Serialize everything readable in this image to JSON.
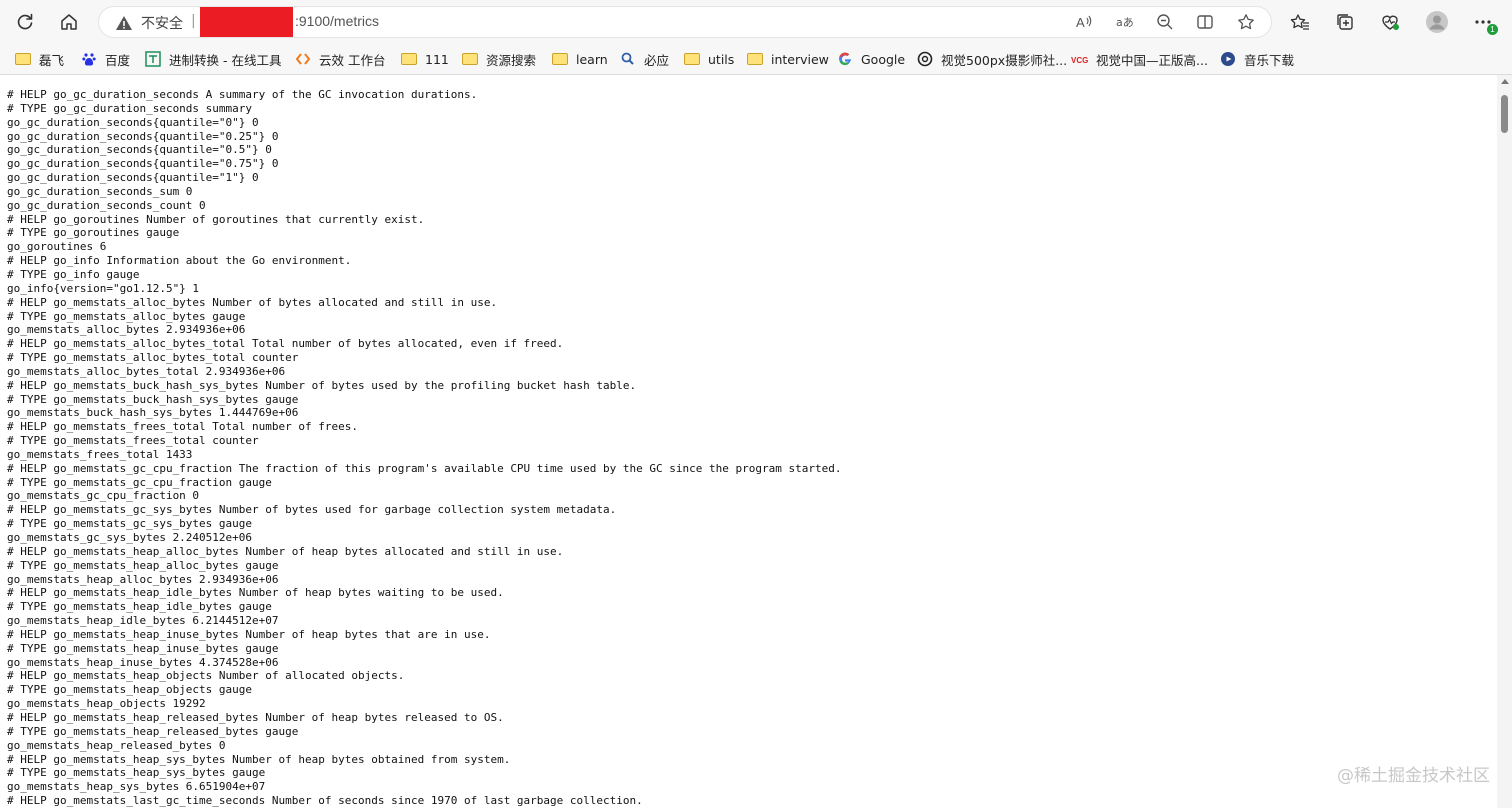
{
  "address_bar": {
    "security_label": "不安全",
    "separator": "|",
    "url_suffix": ":9100/metrics"
  },
  "icons": {
    "reload": "reload-icon",
    "home": "home-icon",
    "warning": "warning-icon",
    "read_aloud": "read-aloud-icon",
    "translate": "translate-icon",
    "zoom": "zoom-icon",
    "split_screen": "split-screen-icon",
    "favorite": "star-icon",
    "favorites": "favorites-icon",
    "collections": "collections-icon",
    "health": "browser-essentials-icon",
    "profile": "profile-icon",
    "more": "more-icon"
  },
  "extension_badge": "1",
  "bookmarks": [
    {
      "label": "磊飞",
      "icon": "folder"
    },
    {
      "label": "百度",
      "icon": "baidu"
    },
    {
      "label": "进制转换 - 在线工具",
      "icon": "tool"
    },
    {
      "label": "云效 工作台",
      "icon": "yunxiao"
    },
    {
      "label": "111",
      "icon": "folder"
    },
    {
      "label": "资源搜索",
      "icon": "folder"
    },
    {
      "label": "learn",
      "icon": "folder"
    },
    {
      "label": "必应",
      "icon": "search"
    },
    {
      "label": "utils",
      "icon": "folder"
    },
    {
      "label": "interview",
      "icon": "folder"
    },
    {
      "label": "Google",
      "icon": "google"
    },
    {
      "label": "视觉500px摄影师社...",
      "icon": "500px"
    },
    {
      "label": "视觉中国—正版高...",
      "icon": "vcg"
    },
    {
      "label": "音乐下载",
      "icon": "music"
    }
  ],
  "metrics_lines": [
    "# HELP go_gc_duration_seconds A summary of the GC invocation durations.",
    "# TYPE go_gc_duration_seconds summary",
    "go_gc_duration_seconds{quantile=\"0\"} 0",
    "go_gc_duration_seconds{quantile=\"0.25\"} 0",
    "go_gc_duration_seconds{quantile=\"0.5\"} 0",
    "go_gc_duration_seconds{quantile=\"0.75\"} 0",
    "go_gc_duration_seconds{quantile=\"1\"} 0",
    "go_gc_duration_seconds_sum 0",
    "go_gc_duration_seconds_count 0",
    "# HELP go_goroutines Number of goroutines that currently exist.",
    "# TYPE go_goroutines gauge",
    "go_goroutines 6",
    "# HELP go_info Information about the Go environment.",
    "# TYPE go_info gauge",
    "go_info{version=\"go1.12.5\"} 1",
    "# HELP go_memstats_alloc_bytes Number of bytes allocated and still in use.",
    "# TYPE go_memstats_alloc_bytes gauge",
    "go_memstats_alloc_bytes 2.934936e+06",
    "# HELP go_memstats_alloc_bytes_total Total number of bytes allocated, even if freed.",
    "# TYPE go_memstats_alloc_bytes_total counter",
    "go_memstats_alloc_bytes_total 2.934936e+06",
    "# HELP go_memstats_buck_hash_sys_bytes Number of bytes used by the profiling bucket hash table.",
    "# TYPE go_memstats_buck_hash_sys_bytes gauge",
    "go_memstats_buck_hash_sys_bytes 1.444769e+06",
    "# HELP go_memstats_frees_total Total number of frees.",
    "# TYPE go_memstats_frees_total counter",
    "go_memstats_frees_total 1433",
    "# HELP go_memstats_gc_cpu_fraction The fraction of this program's available CPU time used by the GC since the program started.",
    "# TYPE go_memstats_gc_cpu_fraction gauge",
    "go_memstats_gc_cpu_fraction 0",
    "# HELP go_memstats_gc_sys_bytes Number of bytes used for garbage collection system metadata.",
    "# TYPE go_memstats_gc_sys_bytes gauge",
    "go_memstats_gc_sys_bytes 2.240512e+06",
    "# HELP go_memstats_heap_alloc_bytes Number of heap bytes allocated and still in use.",
    "# TYPE go_memstats_heap_alloc_bytes gauge",
    "go_memstats_heap_alloc_bytes 2.934936e+06",
    "# HELP go_memstats_heap_idle_bytes Number of heap bytes waiting to be used.",
    "# TYPE go_memstats_heap_idle_bytes gauge",
    "go_memstats_heap_idle_bytes 6.2144512e+07",
    "# HELP go_memstats_heap_inuse_bytes Number of heap bytes that are in use.",
    "# TYPE go_memstats_heap_inuse_bytes gauge",
    "go_memstats_heap_inuse_bytes 4.374528e+06",
    "# HELP go_memstats_heap_objects Number of allocated objects.",
    "# TYPE go_memstats_heap_objects gauge",
    "go_memstats_heap_objects 19292",
    "# HELP go_memstats_heap_released_bytes Number of heap bytes released to OS.",
    "# TYPE go_memstats_heap_released_bytes gauge",
    "go_memstats_heap_released_bytes 0",
    "# HELP go_memstats_heap_sys_bytes Number of heap bytes obtained from system.",
    "# TYPE go_memstats_heap_sys_bytes gauge",
    "go_memstats_heap_sys_bytes 6.651904e+07",
    "# HELP go_memstats_last_gc_time_seconds Number of seconds since 1970 of last garbage collection."
  ],
  "watermark": "@稀土掘金技术社区"
}
